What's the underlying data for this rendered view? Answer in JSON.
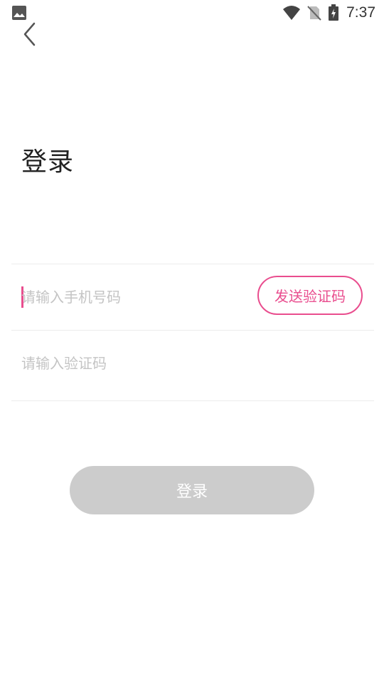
{
  "status_bar": {
    "time": "7:37",
    "icons": [
      "gallery-icon",
      "wifi-icon",
      "no-sim-icon",
      "battery-charging-icon"
    ]
  },
  "header": {
    "back_icon": "chevron-left-icon"
  },
  "page": {
    "title": "登录"
  },
  "form": {
    "phone_placeholder": "请输入手机号码",
    "phone_value": "",
    "send_code_label": "发送验证码",
    "code_placeholder": "请输入验证码",
    "code_value": "",
    "login_label": "登录"
  },
  "colors": {
    "accent": "#e94d8e",
    "disabled_button": "#cccccc",
    "placeholder": "#c4c4c4",
    "divider": "#ececec"
  }
}
